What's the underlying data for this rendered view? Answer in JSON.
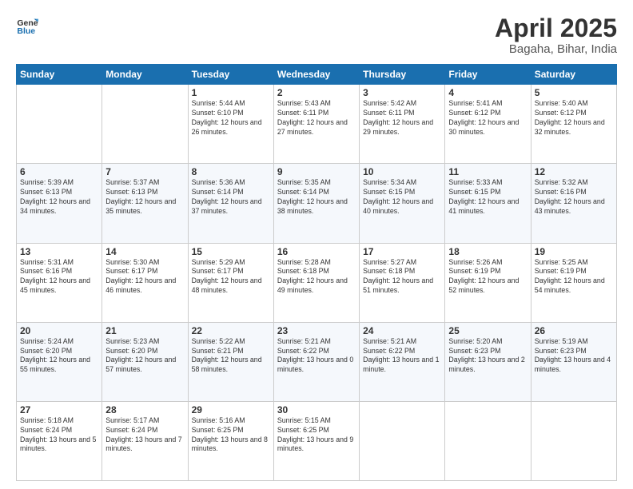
{
  "header": {
    "logo_general": "General",
    "logo_blue": "Blue",
    "month_title": "April 2025",
    "location": "Bagaha, Bihar, India"
  },
  "weekdays": [
    "Sunday",
    "Monday",
    "Tuesday",
    "Wednesday",
    "Thursday",
    "Friday",
    "Saturday"
  ],
  "weeks": [
    [
      {
        "num": "",
        "info": ""
      },
      {
        "num": "",
        "info": ""
      },
      {
        "num": "1",
        "info": "Sunrise: 5:44 AM\nSunset: 6:10 PM\nDaylight: 12 hours and 26 minutes."
      },
      {
        "num": "2",
        "info": "Sunrise: 5:43 AM\nSunset: 6:11 PM\nDaylight: 12 hours and 27 minutes."
      },
      {
        "num": "3",
        "info": "Sunrise: 5:42 AM\nSunset: 6:11 PM\nDaylight: 12 hours and 29 minutes."
      },
      {
        "num": "4",
        "info": "Sunrise: 5:41 AM\nSunset: 6:12 PM\nDaylight: 12 hours and 30 minutes."
      },
      {
        "num": "5",
        "info": "Sunrise: 5:40 AM\nSunset: 6:12 PM\nDaylight: 12 hours and 32 minutes."
      }
    ],
    [
      {
        "num": "6",
        "info": "Sunrise: 5:39 AM\nSunset: 6:13 PM\nDaylight: 12 hours and 34 minutes."
      },
      {
        "num": "7",
        "info": "Sunrise: 5:37 AM\nSunset: 6:13 PM\nDaylight: 12 hours and 35 minutes."
      },
      {
        "num": "8",
        "info": "Sunrise: 5:36 AM\nSunset: 6:14 PM\nDaylight: 12 hours and 37 minutes."
      },
      {
        "num": "9",
        "info": "Sunrise: 5:35 AM\nSunset: 6:14 PM\nDaylight: 12 hours and 38 minutes."
      },
      {
        "num": "10",
        "info": "Sunrise: 5:34 AM\nSunset: 6:15 PM\nDaylight: 12 hours and 40 minutes."
      },
      {
        "num": "11",
        "info": "Sunrise: 5:33 AM\nSunset: 6:15 PM\nDaylight: 12 hours and 41 minutes."
      },
      {
        "num": "12",
        "info": "Sunrise: 5:32 AM\nSunset: 6:16 PM\nDaylight: 12 hours and 43 minutes."
      }
    ],
    [
      {
        "num": "13",
        "info": "Sunrise: 5:31 AM\nSunset: 6:16 PM\nDaylight: 12 hours and 45 minutes."
      },
      {
        "num": "14",
        "info": "Sunrise: 5:30 AM\nSunset: 6:17 PM\nDaylight: 12 hours and 46 minutes."
      },
      {
        "num": "15",
        "info": "Sunrise: 5:29 AM\nSunset: 6:17 PM\nDaylight: 12 hours and 48 minutes."
      },
      {
        "num": "16",
        "info": "Sunrise: 5:28 AM\nSunset: 6:18 PM\nDaylight: 12 hours and 49 minutes."
      },
      {
        "num": "17",
        "info": "Sunrise: 5:27 AM\nSunset: 6:18 PM\nDaylight: 12 hours and 51 minutes."
      },
      {
        "num": "18",
        "info": "Sunrise: 5:26 AM\nSunset: 6:19 PM\nDaylight: 12 hours and 52 minutes."
      },
      {
        "num": "19",
        "info": "Sunrise: 5:25 AM\nSunset: 6:19 PM\nDaylight: 12 hours and 54 minutes."
      }
    ],
    [
      {
        "num": "20",
        "info": "Sunrise: 5:24 AM\nSunset: 6:20 PM\nDaylight: 12 hours and 55 minutes."
      },
      {
        "num": "21",
        "info": "Sunrise: 5:23 AM\nSunset: 6:20 PM\nDaylight: 12 hours and 57 minutes."
      },
      {
        "num": "22",
        "info": "Sunrise: 5:22 AM\nSunset: 6:21 PM\nDaylight: 12 hours and 58 minutes."
      },
      {
        "num": "23",
        "info": "Sunrise: 5:21 AM\nSunset: 6:22 PM\nDaylight: 13 hours and 0 minutes."
      },
      {
        "num": "24",
        "info": "Sunrise: 5:21 AM\nSunset: 6:22 PM\nDaylight: 13 hours and 1 minute."
      },
      {
        "num": "25",
        "info": "Sunrise: 5:20 AM\nSunset: 6:23 PM\nDaylight: 13 hours and 2 minutes."
      },
      {
        "num": "26",
        "info": "Sunrise: 5:19 AM\nSunset: 6:23 PM\nDaylight: 13 hours and 4 minutes."
      }
    ],
    [
      {
        "num": "27",
        "info": "Sunrise: 5:18 AM\nSunset: 6:24 PM\nDaylight: 13 hours and 5 minutes."
      },
      {
        "num": "28",
        "info": "Sunrise: 5:17 AM\nSunset: 6:24 PM\nDaylight: 13 hours and 7 minutes."
      },
      {
        "num": "29",
        "info": "Sunrise: 5:16 AM\nSunset: 6:25 PM\nDaylight: 13 hours and 8 minutes."
      },
      {
        "num": "30",
        "info": "Sunrise: 5:15 AM\nSunset: 6:25 PM\nDaylight: 13 hours and 9 minutes."
      },
      {
        "num": "",
        "info": ""
      },
      {
        "num": "",
        "info": ""
      },
      {
        "num": "",
        "info": ""
      }
    ]
  ]
}
